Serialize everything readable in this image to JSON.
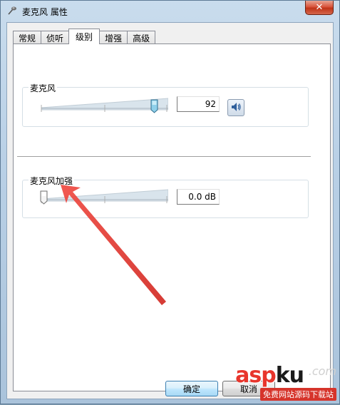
{
  "window": {
    "title": "麦克风 属性",
    "close_label": "✕"
  },
  "tabs": [
    {
      "label": "常规",
      "active": false
    },
    {
      "label": "侦听",
      "active": false
    },
    {
      "label": "级别",
      "active": true
    },
    {
      "label": "增强",
      "active": false
    },
    {
      "label": "高级",
      "active": false
    }
  ],
  "microphone": {
    "label": "麦克风",
    "value": "92",
    "level_percent": 92
  },
  "boost": {
    "label": "麦克风加强",
    "value": "0.0 dB",
    "level_percent": 0
  },
  "buttons": {
    "ok": "确定",
    "cancel": "取消"
  },
  "watermark": {
    "main": "asp",
    "ku": "ku",
    "sub": "免费网站源码下载站",
    "side": ".com"
  },
  "colors": {
    "accent": "#3c7fb1",
    "annotation_arrow": "#e33b35"
  }
}
